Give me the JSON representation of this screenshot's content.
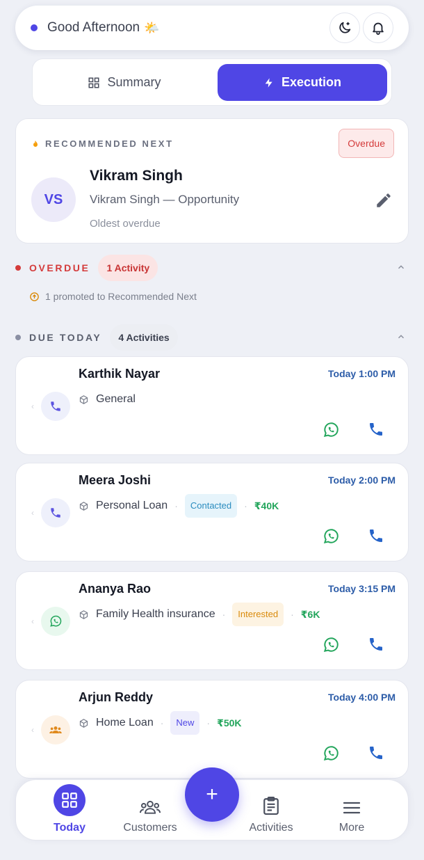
{
  "header": {
    "greeting": "Good Afternoon",
    "greeting_emoji": "🌤️"
  },
  "tabs": {
    "summary": "Summary",
    "execution": "Execution",
    "active": "Execution"
  },
  "recommended": {
    "label": "RECOMMENDED NEXT",
    "status": "Overdue",
    "initials": "VS",
    "name": "Vikram Singh",
    "subtitle": "Vikram Singh — Opportunity",
    "note": "Oldest overdue"
  },
  "overdue": {
    "title": "OVERDUE",
    "count": "1 Activity",
    "promo": "1 promoted to Recommended Next"
  },
  "due_today": {
    "title": "DUE TODAY",
    "count": "4 Activities",
    "items": [
      {
        "name": "Karthik Nayar",
        "time": "Today 1:00 PM",
        "product": "General",
        "type_icon": "phone-icon"
      },
      {
        "name": "Meera Joshi",
        "time": "Today 2:00 PM",
        "product": "Personal Loan",
        "badge": "Contacted",
        "amount": "₹40K",
        "type_icon": "phone-icon"
      },
      {
        "name": "Ananya Rao",
        "time": "Today 3:15 PM",
        "product": "Family Health insurance",
        "badge": "Interested",
        "amount": "₹6K",
        "type_icon": "whatsapp-icon"
      },
      {
        "name": "Arjun Reddy",
        "time": "Today 4:00 PM",
        "product": "Home Loan",
        "badge": "New",
        "amount": "₹50K",
        "type_icon": "meeting-icon"
      }
    ]
  },
  "nav": {
    "today": "Today",
    "customers": "Customers",
    "activities": "Activities",
    "more": "More",
    "fab": "+"
  },
  "colors": {
    "accent": "#4f46e5",
    "overdue": "#d43b3b",
    "amount": "#22a55b",
    "time": "#2c5ca8"
  }
}
